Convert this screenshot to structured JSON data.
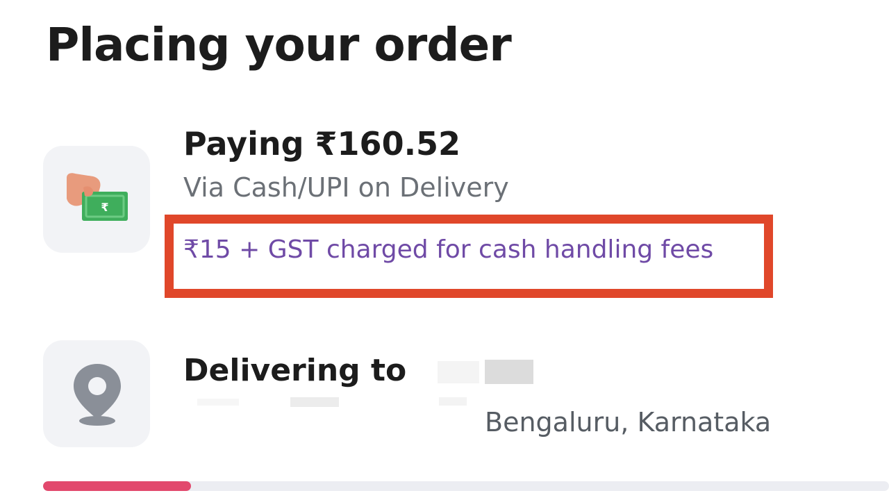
{
  "header": {
    "title": "Placing your order"
  },
  "payment": {
    "icon": "cash-payment-icon",
    "amount_label": "Paying ₹160.52",
    "method": "Via Cash/UPI on Delivery",
    "fee_note": "₹15 + GST charged for cash handling fees",
    "fee_note_color": "#6f4aa6",
    "highlight_color": "#e0472a"
  },
  "delivery": {
    "icon": "location-pin-icon",
    "label": "Delivering to",
    "address_city": "Bengaluru, Karnataka"
  },
  "progress": {
    "fraction": 0.175,
    "color": "#e2496d"
  }
}
